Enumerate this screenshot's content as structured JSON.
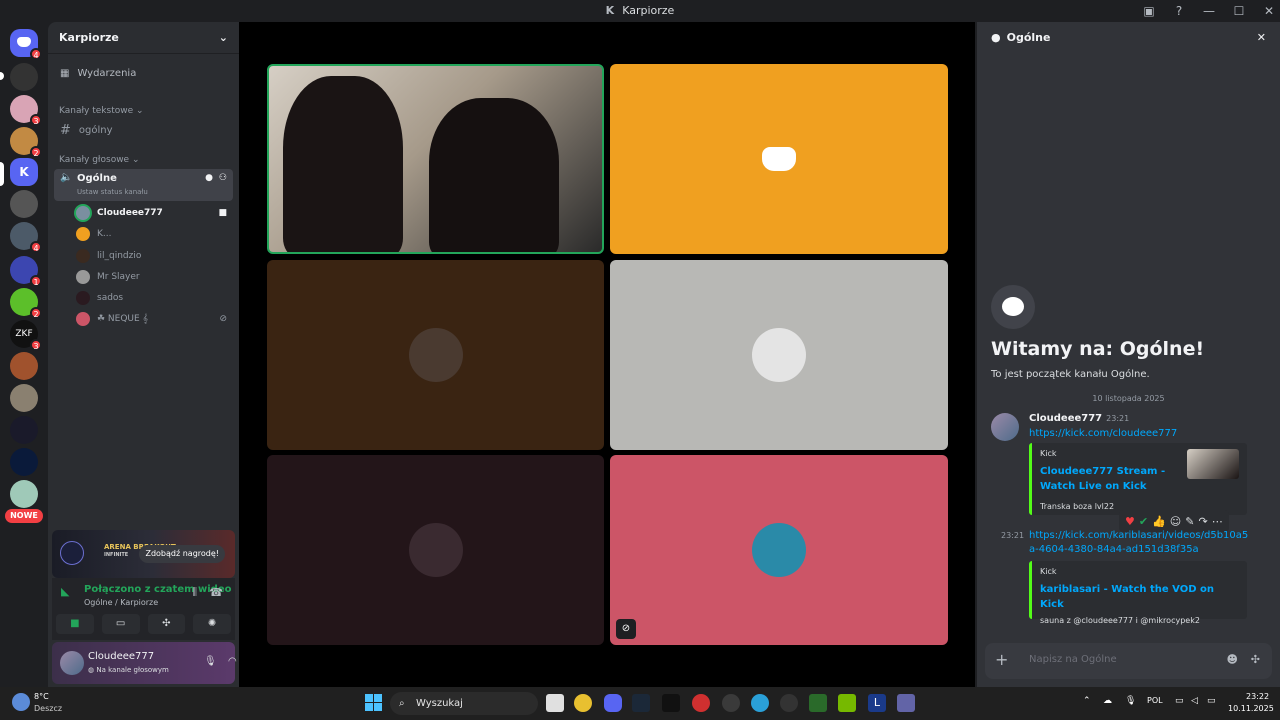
{
  "window": {
    "title": "Karpiorze",
    "logo_letter": "K"
  },
  "rail": {
    "badges": [
      "4",
      "3",
      "2",
      "4",
      "1",
      "2",
      "3"
    ],
    "new_label": "NOWE"
  },
  "sidebar": {
    "server_name": "Karpiorze",
    "events": "Wydarzenia",
    "text_category": "Kanały tekstowe",
    "text_channel": "ogólny",
    "voice_category": "Kanały głosowe",
    "voice_channel": "Ogólne",
    "voice_status": "Ustaw status kanału",
    "users": [
      "Cloudeee777",
      "K...",
      "lil_qindzio",
      "Mr Slayer",
      "sados",
      "☘ NEQUE 𝄞"
    ]
  },
  "promo": {
    "brand": "ARENA BREAKOUT",
    "brand_sub": "INFINITE",
    "button": "Zdobądź nagrodę!"
  },
  "voice_connection": {
    "status": "Połączono z czatem wideo",
    "location": "Ogólne / Karpiorze"
  },
  "user": {
    "name": "Cloudeee777",
    "status": "Na kanale głosowym"
  },
  "chat": {
    "header": "Ogólne",
    "welcome_title": "Witamy na: Ogólne!",
    "welcome_sub": "To jest początek kanału Ogólne.",
    "date": "10 listopada 2025",
    "msg1": {
      "author": "Cloudeee777",
      "time": "23:21",
      "link": "https://kick.com/cloudeee777",
      "embed_provider": "Kick",
      "embed_title": "Cloudeee777 Stream - Watch Live on Kick",
      "embed_desc": "Transka boza lvl22"
    },
    "msg2": {
      "time": "23:21",
      "link": "https://kick.com/kariblasari/videos/d5b10a5a-4604-4380-84a4-ad151d38f35a",
      "embed_provider": "Kick",
      "embed_title": "kariblasari - Watch the VOD on Kick",
      "embed_desc": "sauna z @cloudeee777 i @mikrocypek2"
    },
    "composer_placeholder": "Napisz na Ogólne"
  },
  "taskbar": {
    "weather_temp": "8°C",
    "weather_desc": "Deszcz",
    "search": "Wyszukaj",
    "lang": "POL",
    "time": "23:22",
    "date": "10.11.2025"
  },
  "colors": {
    "accent": "#5865f2",
    "speaking": "#23a55a",
    "kick": "#53fc18",
    "tile_orange": "#f0a020",
    "tile_pink": "#cc5567"
  }
}
